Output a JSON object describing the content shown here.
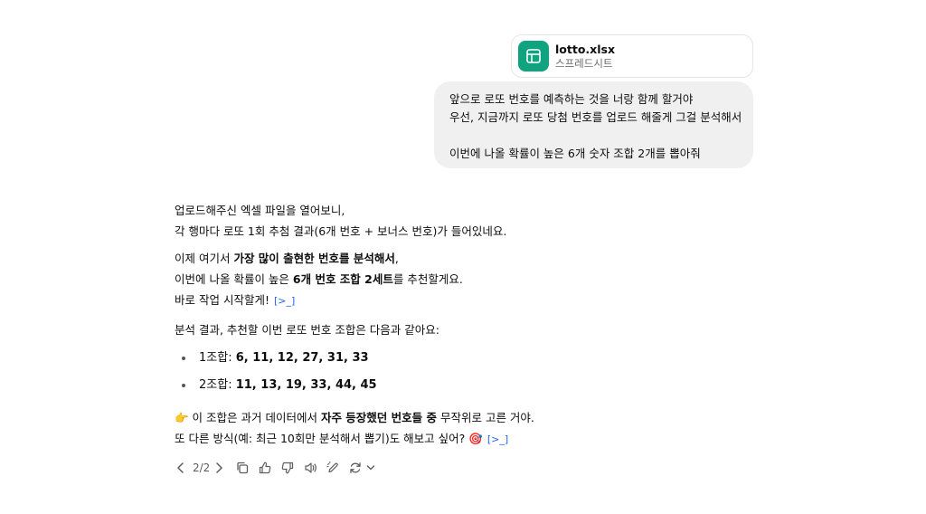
{
  "attachment": {
    "file_name": "lotto.xlsx",
    "file_type": "스프레드시트",
    "icon": "spreadsheet-icon",
    "icon_color": "#10a37f"
  },
  "user_message": {
    "line1": "앞으로 로또 번호를 예측하는 것을 너랑 함께 할거야",
    "line2": "우선, 지금까지 로또 당첨 번호를 업로드 해줄게 그걸 분석해서",
    "line3": "이번에 나올 확률이 높은 6개 숫자 조합 2개를 뽑아줘"
  },
  "assistant": {
    "p1_line1": "업로드해주신 엑셀 파일을 열어보니,",
    "p1_line2": "각 행마다 로또 1회 추첨 결과(6개 번호 + 보너스 번호)가 들어있네요.",
    "p2_line1_pre": "이제 여기서 ",
    "p2_line1_bold": "가장 많이 출현한 번호를 분석해서",
    "p2_line1_post": ",",
    "p2_line2_pre": "이번에 나올 확률이 높은 ",
    "p2_line2_bold": "6개 번호 조합 2세트",
    "p2_line2_post": "를 추천할게요.",
    "p2_line3": "바로 작업 시작할게!",
    "cite_glyph": "[>_]",
    "p3": "분석 결과, 추천할 이번 로또 번호 조합은 다음과 같아요:",
    "combos": [
      {
        "label": "1조합: ",
        "numbers": "6, 11, 12, 27, 31, 33"
      },
      {
        "label": "2조합: ",
        "numbers": "11, 13, 19, 33, 44, 45"
      }
    ],
    "p4_line1_emoji": "👉",
    "p4_line1_pre": " 이 조합은 과거 데이터에서 ",
    "p4_line1_bold": "자주 등장했던 번호들 중",
    "p4_line1_post": " 무작위로 고른 거야.",
    "p4_line2": "또 다른 방식(예: 최근 10회만 분석해서 뽑기)도 해보고 싶어? ",
    "p4_line2_emoji": "🎯"
  },
  "actions": {
    "pager": "2/2",
    "icons": [
      "chevron-left-icon",
      "chevron-right-icon",
      "copy-icon",
      "thumbs-up-icon",
      "thumbs-down-icon",
      "read-aloud-icon",
      "edit-icon",
      "regenerate-icon",
      "chevron-down-icon"
    ]
  }
}
